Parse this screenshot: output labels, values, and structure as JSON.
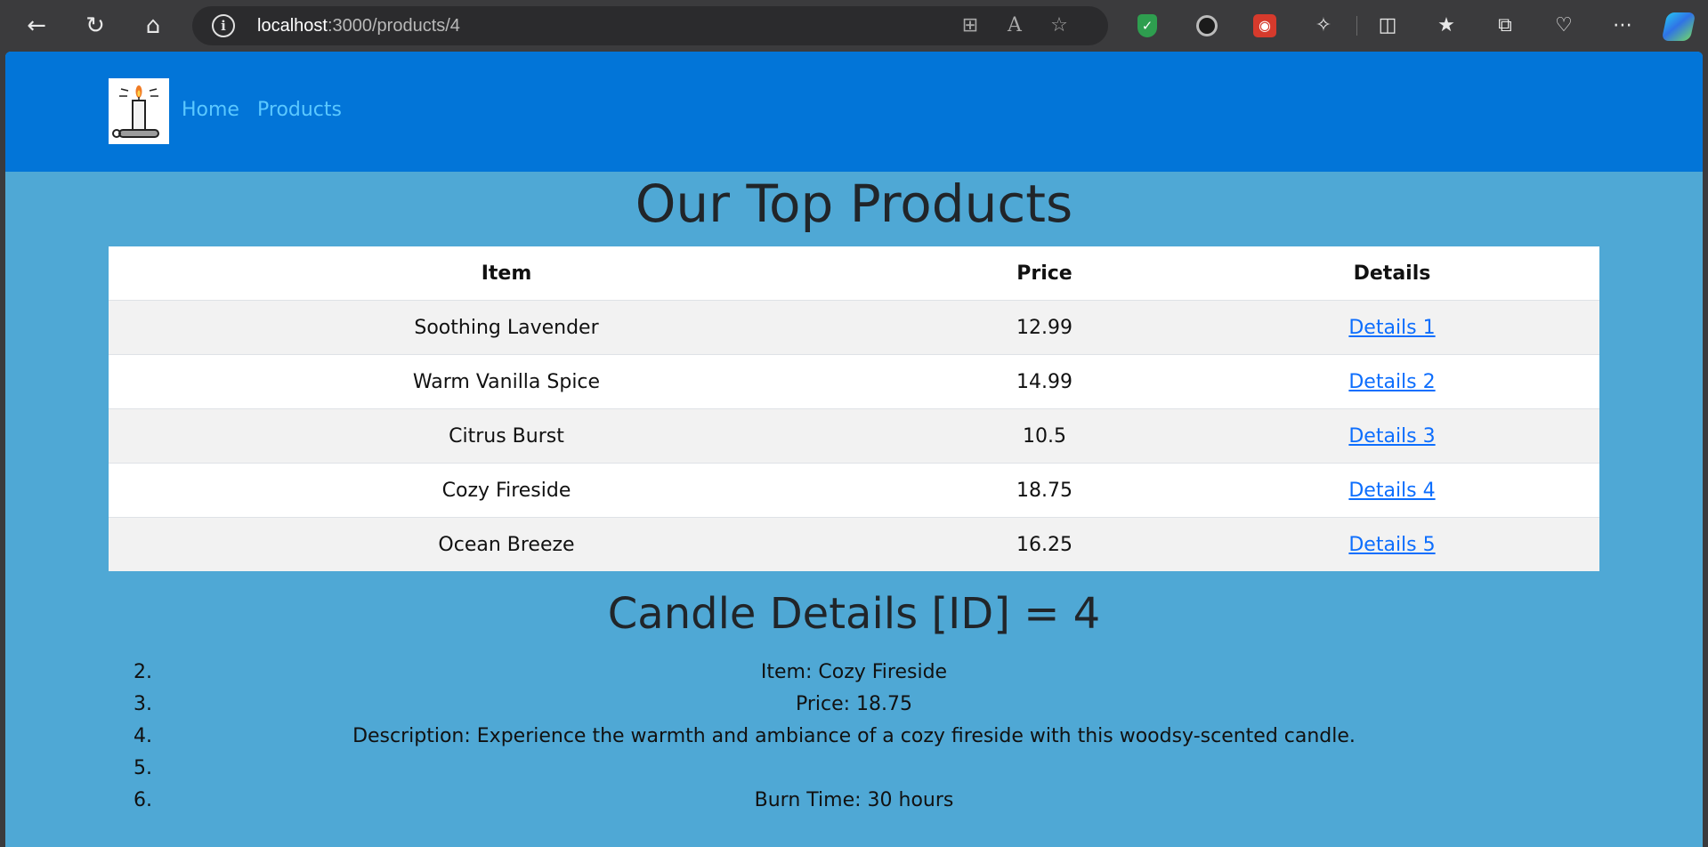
{
  "browser": {
    "url_host": "localhost",
    "url_path": ":3000/products/4"
  },
  "site": {
    "nav": {
      "home": "Home",
      "products": "Products"
    }
  },
  "products_section": {
    "title": "Our Top Products",
    "columns": [
      "Item",
      "Price",
      "Details"
    ],
    "rows": [
      {
        "item": "Soothing Lavender",
        "price": "12.99",
        "details": "Details 1"
      },
      {
        "item": "Warm Vanilla Spice",
        "price": "14.99",
        "details": "Details 2"
      },
      {
        "item": "Citrus Burst",
        "price": "10.5",
        "details": "Details 3"
      },
      {
        "item": "Cozy Fireside",
        "price": "18.75",
        "details": "Details 4"
      },
      {
        "item": "Ocean Breeze",
        "price": "16.25",
        "details": "Details 5"
      }
    ]
  },
  "details_section": {
    "title": "Candle Details [ID] = 4",
    "list": [
      {
        "num": "2.",
        "text": "Item: Cozy Fireside"
      },
      {
        "num": "3.",
        "text": "Price: 18.75"
      },
      {
        "num": "4.",
        "text": "Description: Experience the warmth and ambiance of a cozy fireside with this woodsy-scented candle."
      },
      {
        "num": "5.",
        "text": ""
      },
      {
        "num": "6.",
        "text": "Burn Time: 30 hours"
      }
    ]
  },
  "colors": {
    "header_bg": "#0275d8",
    "page_bg": "#4fa8d5",
    "nav_link": "#5bc8ff",
    "link": "#0d6efd"
  }
}
